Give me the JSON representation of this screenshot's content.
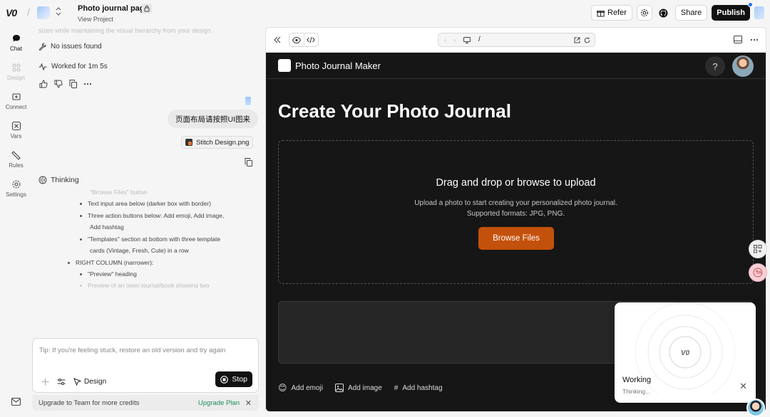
{
  "topbar": {
    "logo": "V0",
    "project_title": "Photo journal page",
    "project_sub": "View Project",
    "refer_label": "Refer",
    "share_label": "Share",
    "publish_label": "Publish"
  },
  "rail": {
    "chat": "Chat",
    "design": "Design",
    "connect": "Connect",
    "vars": "Vars",
    "rules": "Rules",
    "settings": "Settings"
  },
  "chat": {
    "faded_line": "sizes while maintaining the visual hierarchy from your design.",
    "no_issues": "No issues found",
    "worked_for": "Worked for 1m 5s",
    "user_message": "页面布局请按照UI图来",
    "attachment_name": "Stitch Design.png",
    "thinking_label": "Thinking",
    "thinking_lines": [
      "\"Browse Files\" button",
      "Text input area below (darker box with border)",
      "Three action buttons below: Add emoji, Add image,",
      "Add hashtag",
      "\"Templates\" section at bottom with three template",
      "cards (Vintage, Fresh, Cute) in a row",
      "RIGHT COLUMN (narrower):",
      "\"Preview\" heading",
      "Preview of an open journal/book showing two"
    ],
    "composer_placeholder": "Tip: If you're feeling stuck, restore an old version and try again",
    "design_label": "Design",
    "stop_label": "Stop",
    "upgrade_text": "Upgrade to Team for more credits",
    "upgrade_link": "Upgrade Plan"
  },
  "preview": {
    "url": "/",
    "app_name": "Photo Journal Maker",
    "help": "?",
    "page_title": "Create Your Photo Journal",
    "drop_title": "Drag and drop or browse to upload",
    "drop_sub1": "Upload a photo to start creating your personalized photo journal.",
    "drop_sub2": "Supported formats: JPG, PNG.",
    "browse_label": "Browse Files",
    "add_emoji": "Add emoji",
    "add_image": "Add image",
    "add_hashtag": "Add hashtag"
  },
  "toast": {
    "title": "Working",
    "sub": "Thinking..."
  },
  "colors": {
    "accent_orange": "#c4510b",
    "link_green": "#1a8f5a",
    "dark_bg": "#161616"
  }
}
